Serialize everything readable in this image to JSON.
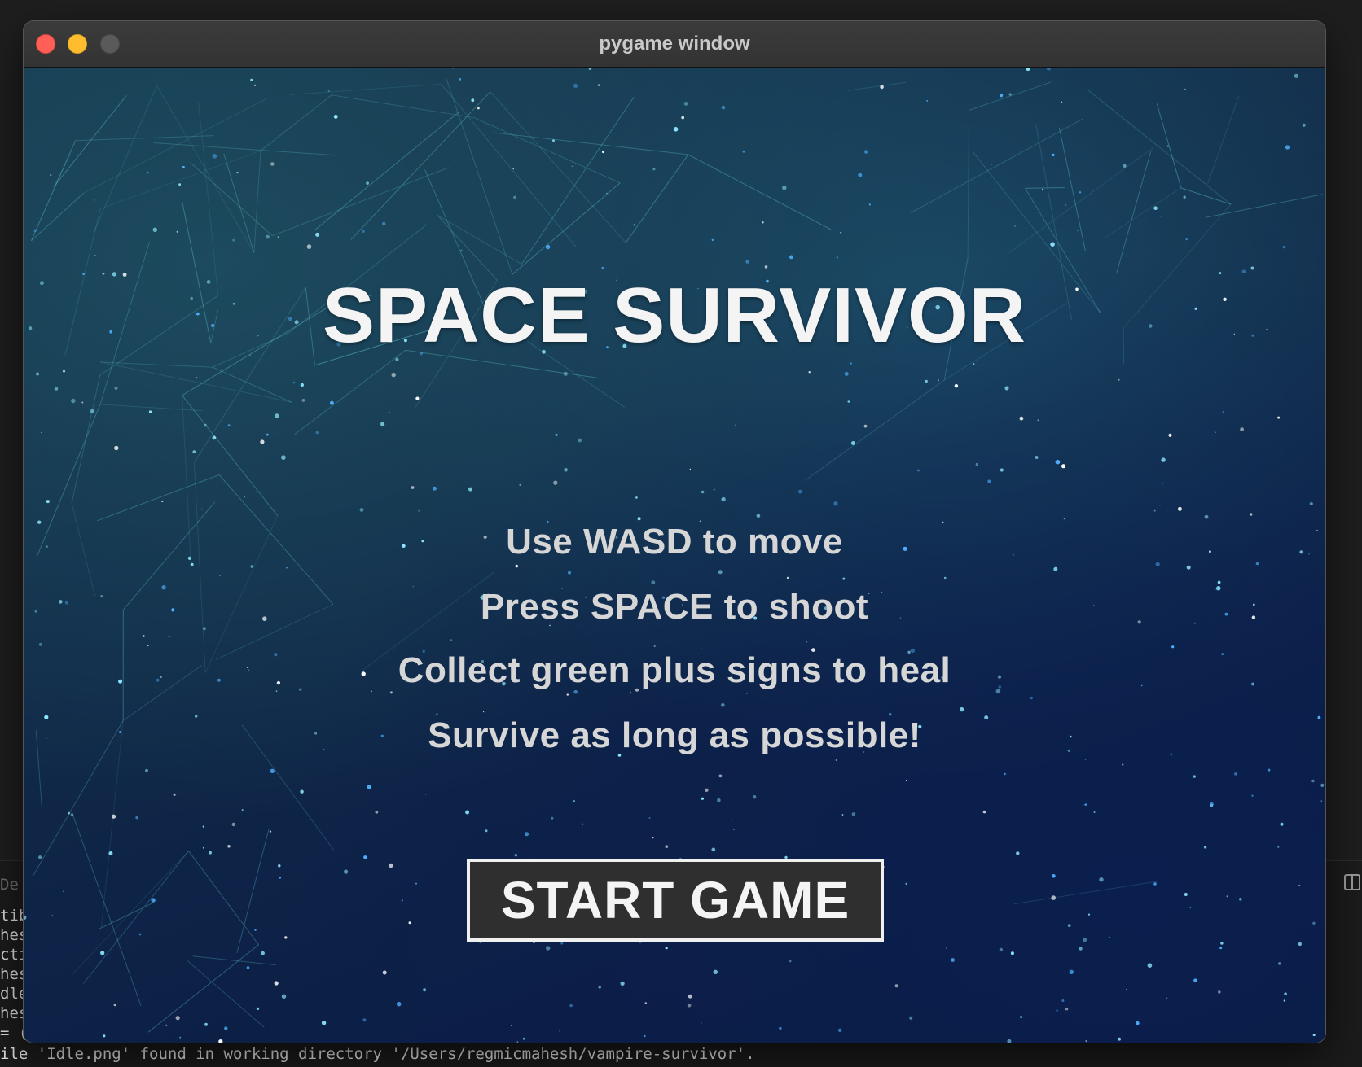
{
  "window": {
    "title": "pygame window"
  },
  "game": {
    "title": "SPACE SURVIVOR",
    "instructions": [
      "Use WASD to move",
      "Press SPACE to shoot",
      "Collect green plus signs to heal",
      "Survive as long as possible!"
    ],
    "start_button": "START GAME"
  },
  "terminal": {
    "tab_label": "De",
    "lines": [
      "tib",
      "hes",
      "cti",
      "hes",
      "dle",
      "hes",
      "= ("
    ],
    "bottom_line": "ile 'Idle.png' found in working directory '/Users/regmicmahesh/vampire-survivor'."
  },
  "colors": {
    "close": "#ff5f57",
    "minimize": "#febc2e",
    "maximize": "#5a5a5a",
    "title_text": "#f4f4f4",
    "instruction_text": "#d6d6d6",
    "button_bg": "#2f2f2f",
    "button_border": "#f0f0f0"
  },
  "icons": [
    "close-button",
    "minimize-button",
    "maximize-button",
    "split-terminal-icon"
  ]
}
